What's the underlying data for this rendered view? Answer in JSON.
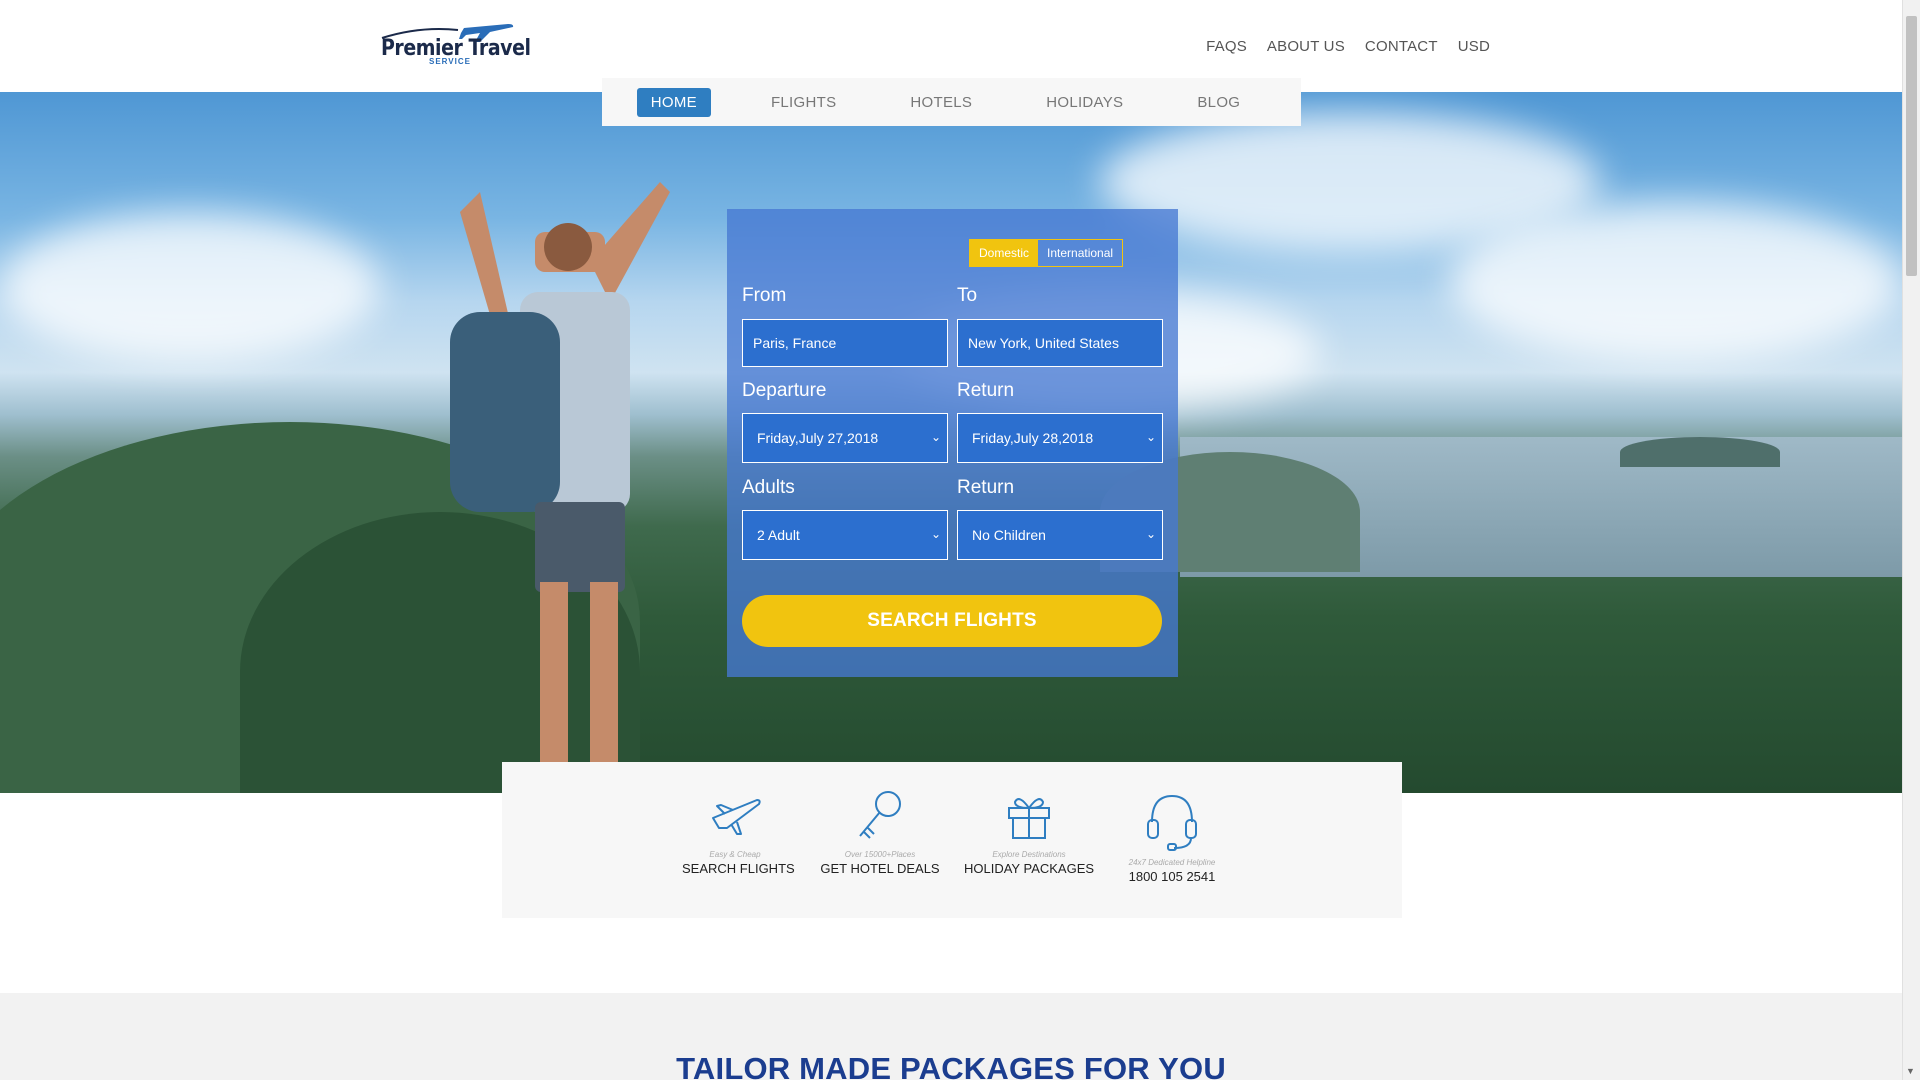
{
  "brand": {
    "name": "Premier Travel",
    "tagline": "SERVICE"
  },
  "top_links": [
    "FAQS",
    "ABOUT US",
    "CONTACT",
    "USD"
  ],
  "nav": {
    "items": [
      "HOME",
      "FLIGHTS",
      "HOTELS",
      "HOLIDAYS",
      "BLOG"
    ],
    "active": "HOME"
  },
  "search": {
    "trip_type": {
      "options": [
        "Domestic",
        "International"
      ],
      "selected": "Domestic"
    },
    "from": {
      "label": "From",
      "value": "Paris, France"
    },
    "to": {
      "label": "To",
      "value": "New York, United States"
    },
    "departure": {
      "label": "Departure",
      "value": "Friday,July 27,2018"
    },
    "return": {
      "label": "Return",
      "value": "Friday,July 28,2018"
    },
    "adults": {
      "label": "Adults",
      "value": "2 Adult"
    },
    "children": {
      "label": "Return",
      "value": "No Children"
    },
    "button": "SEARCH FLIGHTS"
  },
  "features": [
    {
      "icon": "airplane-icon",
      "small": "Easy & Cheap",
      "big": "SEARCH FLIGHTS"
    },
    {
      "icon": "key-icon",
      "small": "Over 15000+Places",
      "big": "GET HOTEL DEALS"
    },
    {
      "icon": "gift-icon",
      "small": "Explore Destinations",
      "big": "HOLIDAY PACKAGES"
    },
    {
      "icon": "headset-icon",
      "small": "24x7 Dedicated Helpline",
      "big": "1800 105 2541"
    }
  ],
  "section_title": "TAILOR MADE PACKAGES FOR YOU",
  "colors": {
    "primary": "#2f7ec1",
    "accent": "#f1c40f",
    "heading": "#1b3d8f",
    "panel": "#4678d2"
  }
}
